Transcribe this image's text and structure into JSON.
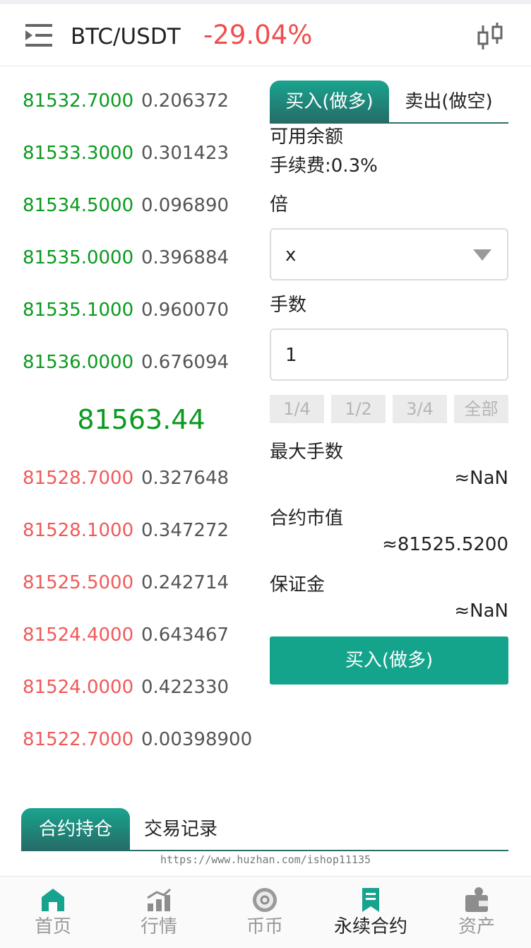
{
  "header": {
    "pair": "BTC/USDT",
    "change": "-29.04%",
    "menu_icon": "menu-icon",
    "kline_icon": "candlestick-icon"
  },
  "orderbook": {
    "asks": [
      {
        "price": "81532.7000",
        "qty": "0.206372"
      },
      {
        "price": "81533.3000",
        "qty": "0.301423"
      },
      {
        "price": "81534.5000",
        "qty": "0.096890"
      },
      {
        "price": "81535.0000",
        "qty": "0.396884"
      },
      {
        "price": "81535.1000",
        "qty": "0.960070"
      },
      {
        "price": "81536.0000",
        "qty": "0.676094"
      }
    ],
    "last_price": "81563.44",
    "bids": [
      {
        "price": "81528.7000",
        "qty": "0.327648"
      },
      {
        "price": "81528.1000",
        "qty": "0.347272"
      },
      {
        "price": "81525.5000",
        "qty": "0.242714"
      },
      {
        "price": "81524.4000",
        "qty": "0.643467"
      },
      {
        "price": "81524.0000",
        "qty": "0.422330"
      },
      {
        "price": "81522.7000",
        "qty": "0.00398900"
      }
    ],
    "colors": {
      "ask": "#0a9a1f",
      "bid": "#f05a5a"
    }
  },
  "trade": {
    "tabs": {
      "buy": "买入(做多)",
      "sell": "卖出(做空)"
    },
    "available_label": "可用余额",
    "fee_label": "手续费:0.3%",
    "leverage_label": "倍",
    "leverage_value": "x",
    "lots_label": "手数",
    "lots_value": "1",
    "fractions": [
      "1/4",
      "1/2",
      "3/4",
      "全部"
    ],
    "max_lots_label": "最大手数",
    "max_lots_value": "≈NaN",
    "contract_value_label": "合约市值",
    "contract_value": "≈81525.5200",
    "margin_label": "保证金",
    "margin_value": "≈NaN",
    "buy_button": "买入(做多)",
    "accent": "#13a48b"
  },
  "positions": {
    "tabs": {
      "positions": "合约持仓",
      "records": "交易记录"
    },
    "watermark": "https://www.huzhan.com/ishop11135"
  },
  "nav": {
    "items": [
      {
        "label": "首页",
        "icon": "home-icon"
      },
      {
        "label": "行情",
        "icon": "market-chart-icon"
      },
      {
        "label": "币币",
        "icon": "coin-icon"
      },
      {
        "label": "永续合约",
        "icon": "contract-bookmark-icon"
      },
      {
        "label": "资产",
        "icon": "wallet-icon"
      }
    ]
  }
}
